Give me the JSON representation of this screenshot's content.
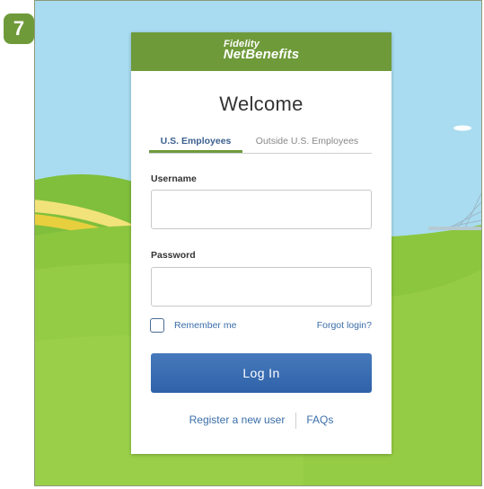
{
  "step_badge": "7",
  "brand": {
    "line1": "Fidelity",
    "line2": "NetBenefits"
  },
  "welcome_title": "Welcome",
  "tabs": [
    {
      "label": "U.S. Employees",
      "active": true
    },
    {
      "label": "Outside U.S. Employees",
      "active": false
    }
  ],
  "username": {
    "label": "Username",
    "value": "",
    "placeholder": ""
  },
  "password": {
    "label": "Password",
    "value": "",
    "placeholder": ""
  },
  "remember_me": {
    "label": "Remember me",
    "checked": false
  },
  "forgot_login": "Forgot login?",
  "login_button": "Log In",
  "footer": {
    "register": "Register a new user",
    "faqs": "FAQs"
  },
  "colors": {
    "brand_green": "#6f9a3a",
    "link_blue": "#3a6ea8",
    "button_blue": "#3a6cb0",
    "sky": "#a9dcf0"
  }
}
